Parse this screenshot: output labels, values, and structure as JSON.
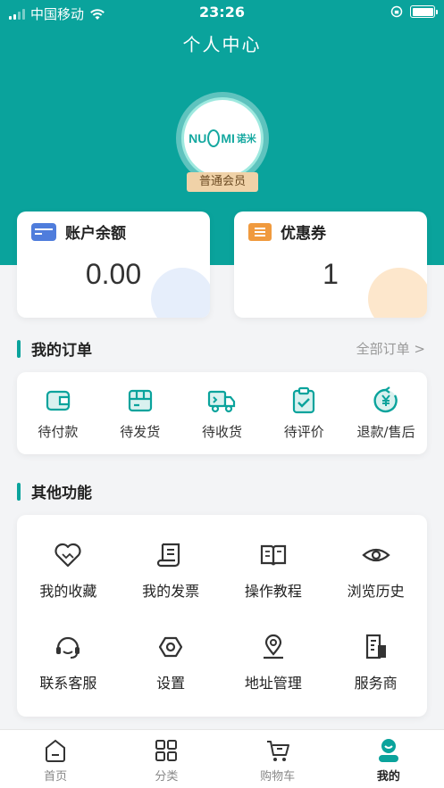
{
  "status_bar": {
    "carrier": "中国移动",
    "time": "23:26"
  },
  "page_title": "个人中心",
  "profile": {
    "logo_text": "NU",
    "logo_text2": "MI",
    "logo_cn": "诺米",
    "member_level": "普通会员"
  },
  "account": {
    "title": "账户余额",
    "value": "0.00"
  },
  "coupon": {
    "title": "优惠券",
    "value": "1"
  },
  "orders": {
    "title": "我的订单",
    "all_label": "全部订单 >",
    "items": [
      {
        "label": "待付款",
        "icon": "wallet-icon"
      },
      {
        "label": "待发货",
        "icon": "package-icon"
      },
      {
        "label": "待收货",
        "icon": "truck-icon"
      },
      {
        "label": "待评价",
        "icon": "clipboard-check-icon"
      },
      {
        "label": "退款/售后",
        "icon": "refund-icon"
      }
    ]
  },
  "others": {
    "title": "其他功能",
    "items": [
      {
        "label": "我的收藏",
        "icon": "heart-icon"
      },
      {
        "label": "我的发票",
        "icon": "invoice-icon"
      },
      {
        "label": "操作教程",
        "icon": "book-icon"
      },
      {
        "label": "浏览历史",
        "icon": "eye-icon"
      },
      {
        "label": "联系客服",
        "icon": "headset-icon"
      },
      {
        "label": "设置",
        "icon": "settings-icon"
      },
      {
        "label": "地址管理",
        "icon": "location-icon"
      },
      {
        "label": "服务商",
        "icon": "building-icon"
      }
    ]
  },
  "tabbar": {
    "items": [
      {
        "label": "首页",
        "icon": "home-icon"
      },
      {
        "label": "分类",
        "icon": "grid-icon"
      },
      {
        "label": "购物车",
        "icon": "cart-icon"
      },
      {
        "label": "我的",
        "icon": "profile-icon"
      }
    ],
    "active": "我的"
  },
  "colors": {
    "primary": "#0aa39c",
    "member_badge": "#f0d2a8",
    "wallet_blue": "#4f7ddc",
    "ticket_orange": "#f09a3e"
  }
}
